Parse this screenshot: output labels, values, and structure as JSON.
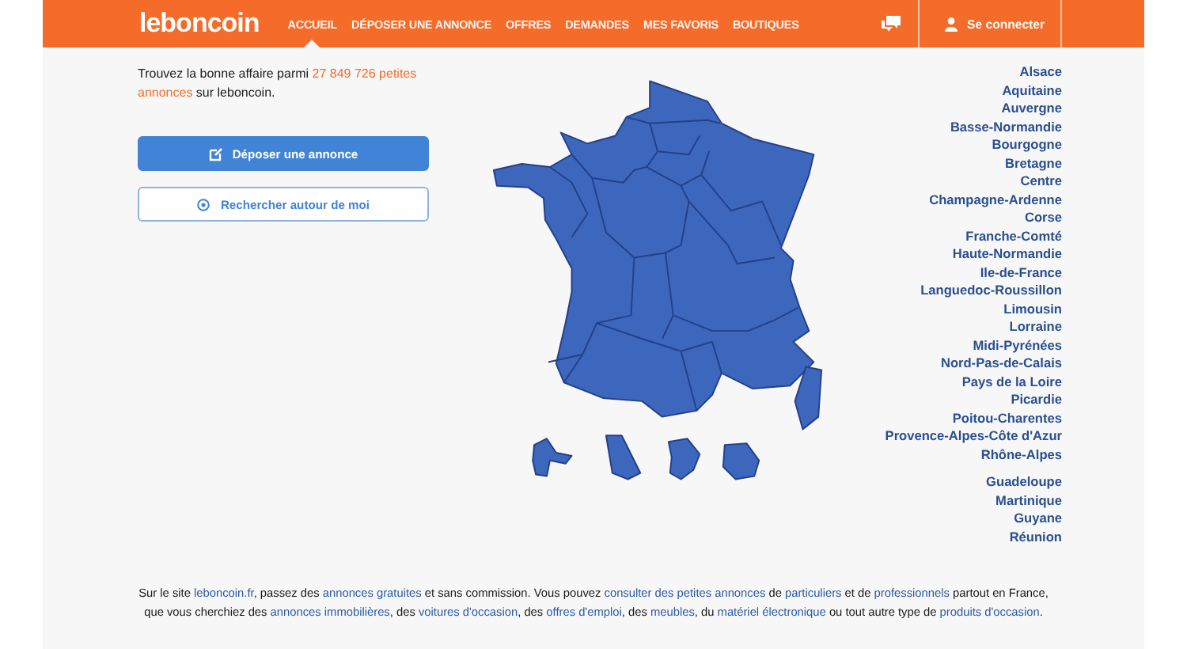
{
  "header": {
    "logo": "leboncoin",
    "nav": [
      {
        "label": "ACCUEIL",
        "selected": true
      },
      {
        "label": "DÉPOSER UNE ANNONCE",
        "selected": false
      },
      {
        "label": "OFFRES",
        "selected": false
      },
      {
        "label": "DEMANDES",
        "selected": false
      },
      {
        "label": "MES FAVORIS",
        "selected": false
      },
      {
        "label": "BOUTIQUES",
        "selected": false
      }
    ],
    "login": "Se connecter"
  },
  "intro": {
    "before": "Trouvez la bonne affaire parmi ",
    "count": "27 849 726 petites annonces",
    "after": " sur leboncoin."
  },
  "buttons": [
    {
      "kind": "primary",
      "label": "Déposer une annonce"
    },
    {
      "kind": "secondary",
      "label": "Rechercher autour de moi"
    }
  ],
  "regions": [
    {
      "items": [
        "Alsace",
        "Aquitaine",
        "Auvergne",
        "Basse-Normandie",
        "Bourgogne",
        "Bretagne",
        "Centre",
        "Champagne-Ardenne",
        "Corse",
        "Franche-Comté",
        "Haute-Normandie",
        "Ile-de-France",
        "Languedoc-Roussillon",
        "Limousin",
        "Lorraine",
        "Midi-Pyrénées",
        "Nord-Pas-de-Calais",
        "Pays de la Loire",
        "Picardie",
        "Poitou-Charentes",
        "Provence-Alpes-Côte d'Azur",
        "Rhône-Alpes"
      ]
    },
    {
      "items": [
        "Guadeloupe",
        "Martinique",
        "Guyane",
        "Réunion"
      ]
    }
  ],
  "footer": [
    {
      "kind": "text",
      "text": "Sur le site "
    },
    {
      "kind": "link",
      "text": "leboncoin.fr"
    },
    {
      "kind": "text",
      "text": ", passez des "
    },
    {
      "kind": "link",
      "text": "annonces gratuites"
    },
    {
      "kind": "text",
      "text": " et sans commission. Vous pouvez "
    },
    {
      "kind": "link",
      "text": "consulter des petites annonces"
    },
    {
      "kind": "text",
      "text": " de "
    },
    {
      "kind": "link",
      "text": "particuliers"
    },
    {
      "kind": "text",
      "text": " et de "
    },
    {
      "kind": "link",
      "text": "professionnels"
    },
    {
      "kind": "text",
      "text": " partout en France, que vous cherchiez des "
    },
    {
      "kind": "link",
      "text": "annonces immobilières"
    },
    {
      "kind": "text",
      "text": ", des "
    },
    {
      "kind": "link",
      "text": "voitures d'occasion"
    },
    {
      "kind": "text",
      "text": ", des "
    },
    {
      "kind": "link",
      "text": "offres d'emploi"
    },
    {
      "kind": "text",
      "text": ", des "
    },
    {
      "kind": "link",
      "text": "meubles"
    },
    {
      "kind": "text",
      "text": ", du "
    },
    {
      "kind": "link",
      "text": "matériel électronique"
    },
    {
      "kind": "text",
      "text": " ou tout autre type de "
    },
    {
      "kind": "link",
      "text": "produits d'occasion"
    },
    {
      "kind": "text",
      "text": "."
    }
  ]
}
